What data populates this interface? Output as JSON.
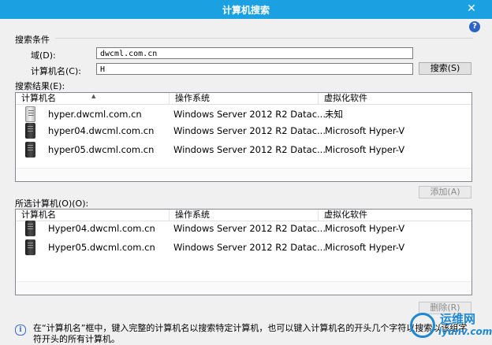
{
  "window": {
    "title": "计算机搜索",
    "close_glyph": "✕",
    "help_glyph": "?"
  },
  "search_criteria": {
    "section_label": "搜索条件",
    "domain_label": "域(D):",
    "domain_value": "dwcml.com.cn",
    "computer_name_label": "计算机名(C):",
    "computer_name_value": "H",
    "search_button": "搜索(S)"
  },
  "results": {
    "section_label": "搜索结果(E):",
    "columns": [
      "计算机名",
      "操作系统",
      "虚拟化软件"
    ],
    "rows": [
      {
        "name": "hyper.dwcml.com.cn",
        "os": "Windows Server 2012 R2 Datac...",
        "virt": "未知",
        "icon": "server-light-icon"
      },
      {
        "name": "hyper04.dwcml.com.cn",
        "os": "Windows Server 2012 R2 Datac...",
        "virt": "Microsoft Hyper-V",
        "icon": "server-icon"
      },
      {
        "name": "hyper05.dwcml.com.cn",
        "os": "Windows Server 2012 R2 Datac...",
        "virt": "Microsoft Hyper-V",
        "icon": "server-icon"
      }
    ],
    "add_button": "添加(A)"
  },
  "selected": {
    "section_label": "所选计算机(O)(O):",
    "columns": [
      "计算机名",
      "操作系统",
      "虚拟化软件"
    ],
    "rows": [
      {
        "name": "Hyper04.dwcml.com.cn",
        "os": "Windows Server 2012 R2 Datac...",
        "virt": "Microsoft Hyper-V",
        "icon": "server-icon"
      },
      {
        "name": "Hyper05.dwcml.com.cn",
        "os": "Windows Server 2012 R2 Datac...",
        "virt": "Microsoft Hyper-V",
        "icon": "server-icon"
      }
    ],
    "remove_button": "删除(R)"
  },
  "info": {
    "text": "在“计算机名”框中，键入完整的计算机名以搜索特定计算机，也可以键入计算机名的开头几个字符以搜索以该组字符开头的所有计算机。"
  },
  "watermark": {
    "brand": "运维网",
    "site": "iyunv.com"
  },
  "colors": {
    "titlebar": "#1ba1e2",
    "accent": "#1e88d0"
  }
}
